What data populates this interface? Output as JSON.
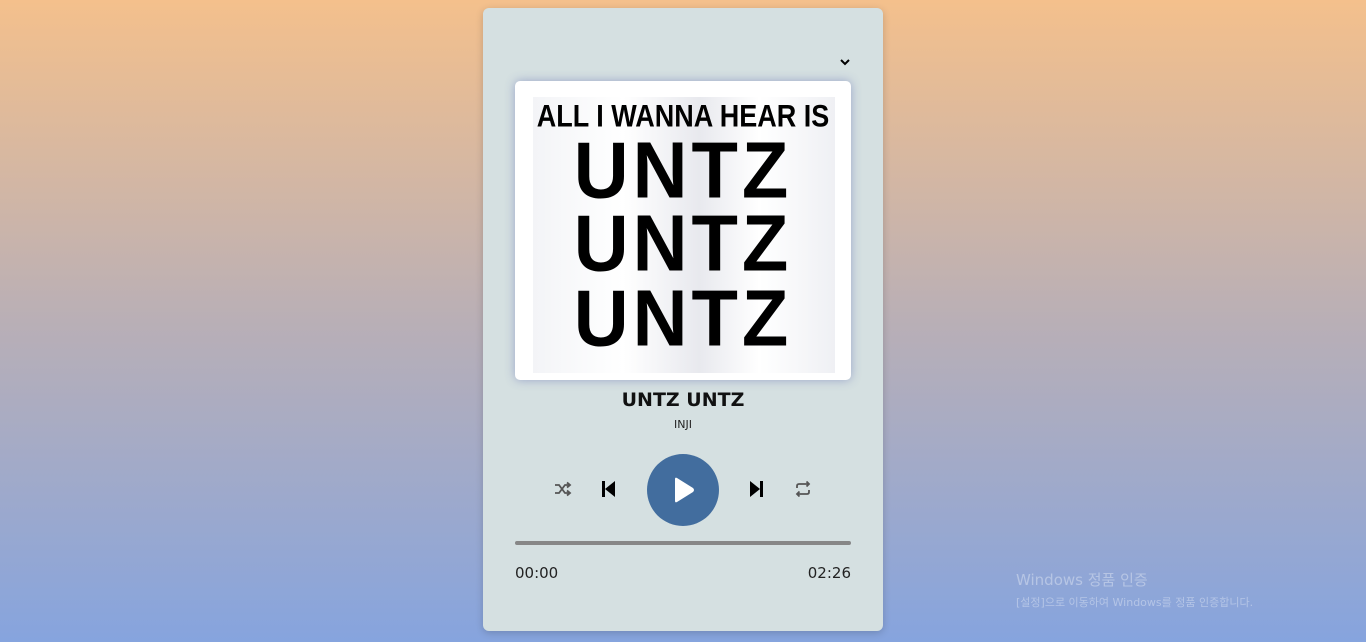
{
  "album_art": {
    "line1": "ALL I WANNA HEAR IS",
    "repeat_text": "UNTZ"
  },
  "track": {
    "title": "UNTZ UNTZ",
    "artist": "INJI"
  },
  "controls": {
    "shuffle_icon": "shuffle-icon",
    "prev_icon": "skip-previous-icon",
    "play_icon": "play-icon",
    "next_icon": "skip-next-icon",
    "repeat_icon": "repeat-icon",
    "menu_icon": "chevron-down-icon"
  },
  "progress": {
    "current": "00:00",
    "duration": "02:26",
    "fraction": 0
  },
  "colors": {
    "accent": "#426d9e",
    "card": "#d5e0e1",
    "track_bar": "#878787"
  },
  "watermark": {
    "line1": "Windows 정품 인증",
    "line2": "[설정]으로 이동하여 Windows를 정품 인증합니다."
  }
}
